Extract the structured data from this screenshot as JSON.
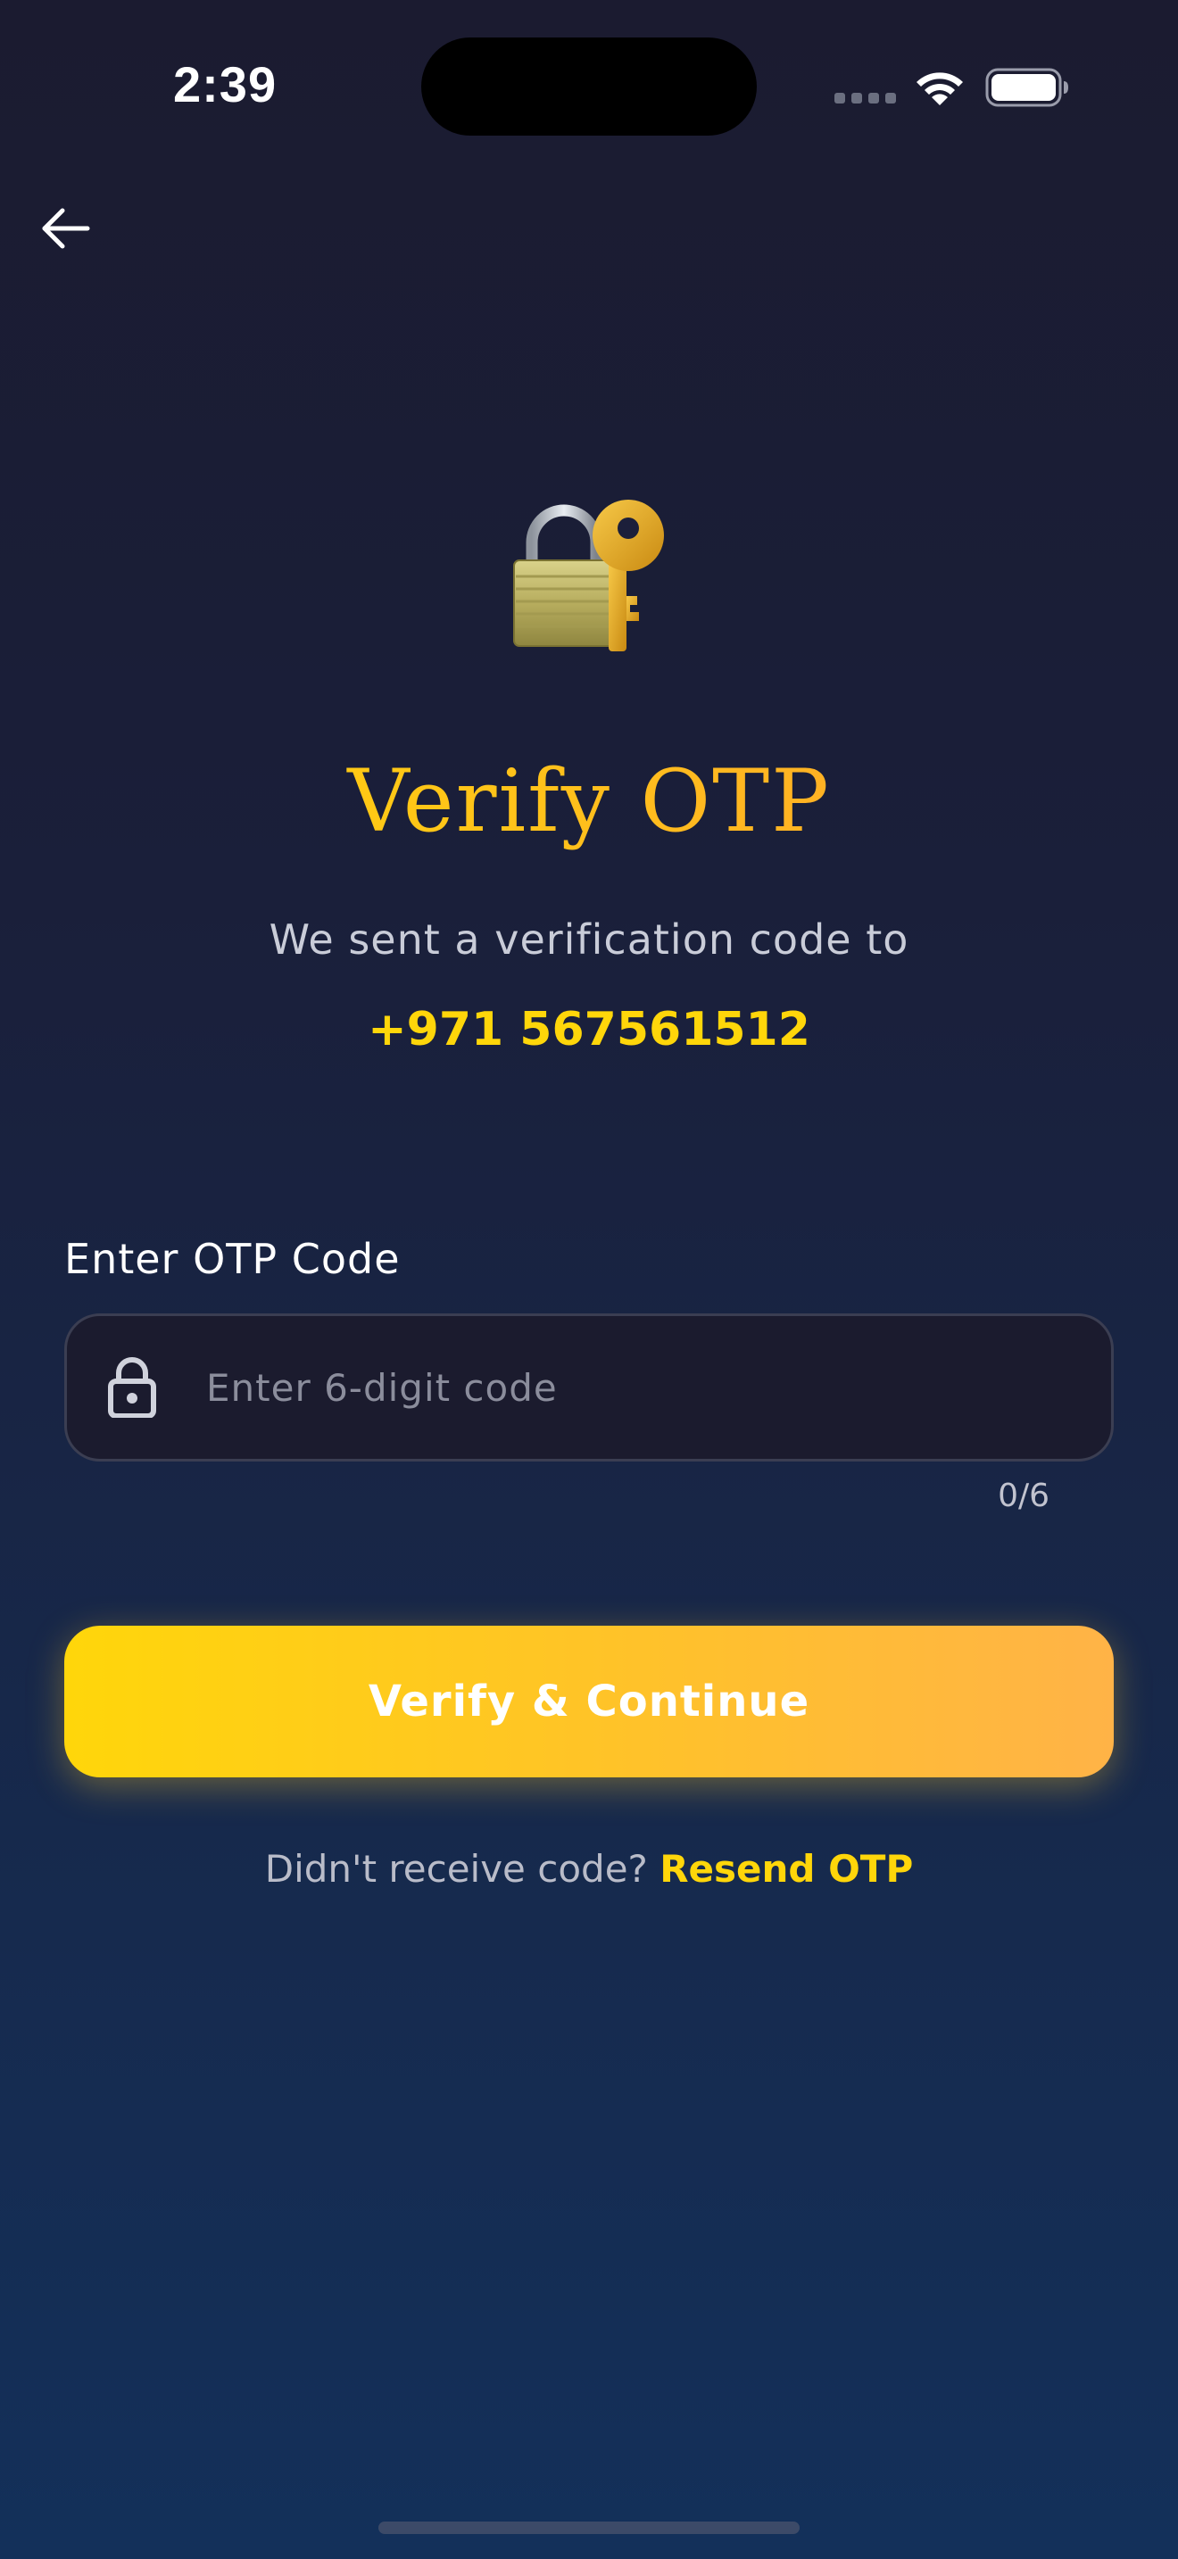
{
  "status_bar": {
    "time": "2:39"
  },
  "header": {
    "back_icon": "arrow-left-icon"
  },
  "hero": {
    "illustration": "locked-with-key-icon",
    "title": "Verify OTP",
    "subtitle": "We sent a verification code to",
    "phone_number": "+971 567561512"
  },
  "otp_field": {
    "label": "Enter OTP Code",
    "placeholder": "Enter 6-digit code",
    "value": "",
    "icon": "lock-icon",
    "counter": "0/6"
  },
  "verify_button": {
    "label": "Verify & Continue"
  },
  "resend": {
    "prompt": "Didn't receive code?",
    "link_label": "Resend OTP"
  },
  "colors": {
    "accent": "#ffd60a",
    "accent_end": "#ffb347",
    "background_top": "#1b1b30",
    "background_bottom": "#13305a",
    "input_background": "#1b1b2e"
  }
}
